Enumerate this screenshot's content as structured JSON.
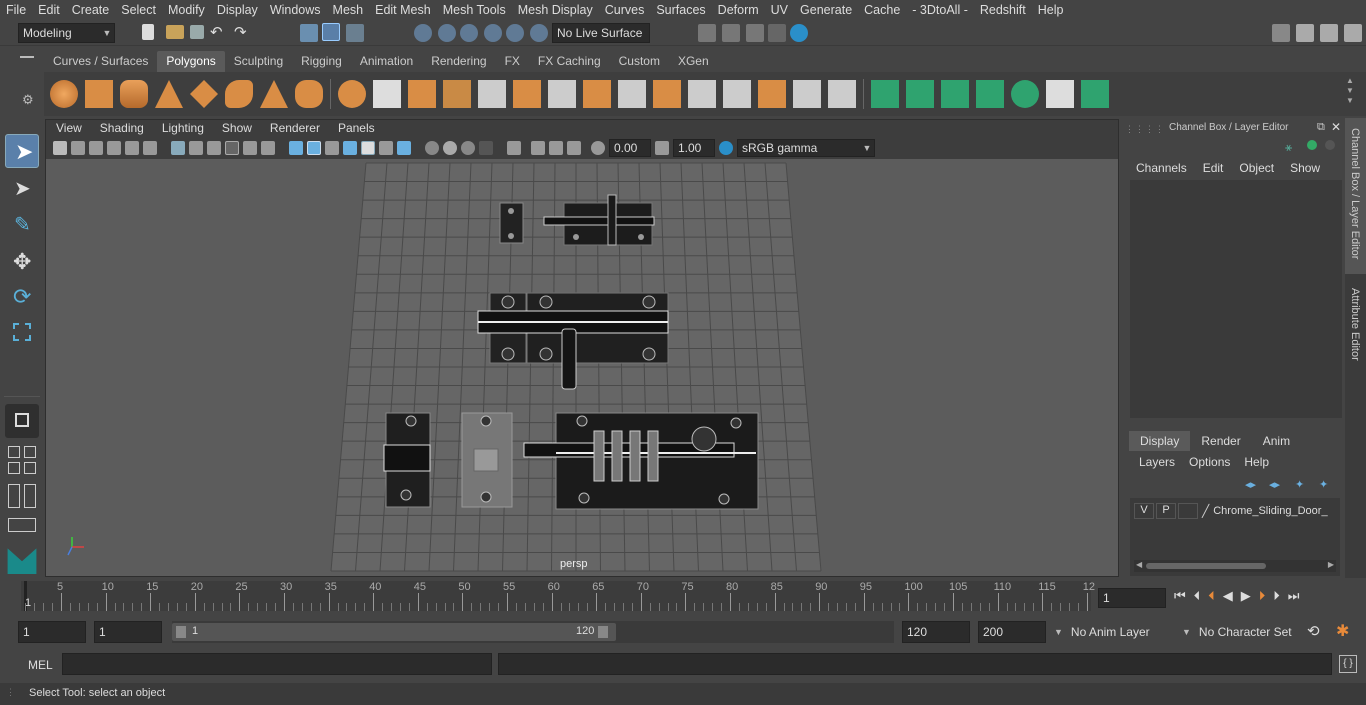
{
  "menu": [
    "File",
    "Edit",
    "Create",
    "Select",
    "Modify",
    "Display",
    "Windows",
    "Mesh",
    "Edit Mesh",
    "Mesh Tools",
    "Mesh Display",
    "Curves",
    "Surfaces",
    "Deform",
    "UV",
    "Generate",
    "Cache",
    "- 3DtoAll -",
    "Redshift",
    "Help"
  ],
  "status": {
    "mode": "Modeling",
    "live_surface": "No Live Surface"
  },
  "shelf_tabs": [
    "Curves / Surfaces",
    "Polygons",
    "Sculpting",
    "Rigging",
    "Animation",
    "Rendering",
    "FX",
    "FX Caching",
    "Custom",
    "XGen"
  ],
  "shelf_active": "Polygons",
  "viewport": {
    "menu": [
      "View",
      "Shading",
      "Lighting",
      "Show",
      "Renderer",
      "Panels"
    ],
    "exposure": "0.00",
    "gamma": "1.00",
    "color_space": "sRGB gamma",
    "camera_label": "persp"
  },
  "channel_box": {
    "title": "Channel Box / Layer Editor",
    "menu": [
      "Channels",
      "Edit",
      "Object",
      "Show"
    ]
  },
  "layer_editor": {
    "tabs": [
      "Display",
      "Render",
      "Anim"
    ],
    "active_tab": "Display",
    "menu": [
      "Layers",
      "Options",
      "Help"
    ],
    "layer": {
      "v": "V",
      "p": "P",
      "name": "Chrome_Sliding_Door_"
    }
  },
  "side_tabs": [
    "Channel Box / Layer Editor",
    "Attribute Editor"
  ],
  "timeline": {
    "ticks": [
      "5",
      "10",
      "15",
      "20",
      "25",
      "30",
      "35",
      "40",
      "45",
      "50",
      "55",
      "60",
      "65",
      "70",
      "75",
      "80",
      "85",
      "90",
      "95",
      "100",
      "105",
      "110",
      "115",
      "12"
    ],
    "start_mark": "1",
    "current_frame": "1"
  },
  "range": {
    "start": "1",
    "playback_start": "1",
    "slider_start": "1",
    "slider_end": "120",
    "playback_end": "120",
    "end": "200",
    "anim_layer": "No Anim Layer",
    "char_set": "No Character Set"
  },
  "command": {
    "lang": "MEL"
  },
  "help_text": "Select Tool: select an object"
}
